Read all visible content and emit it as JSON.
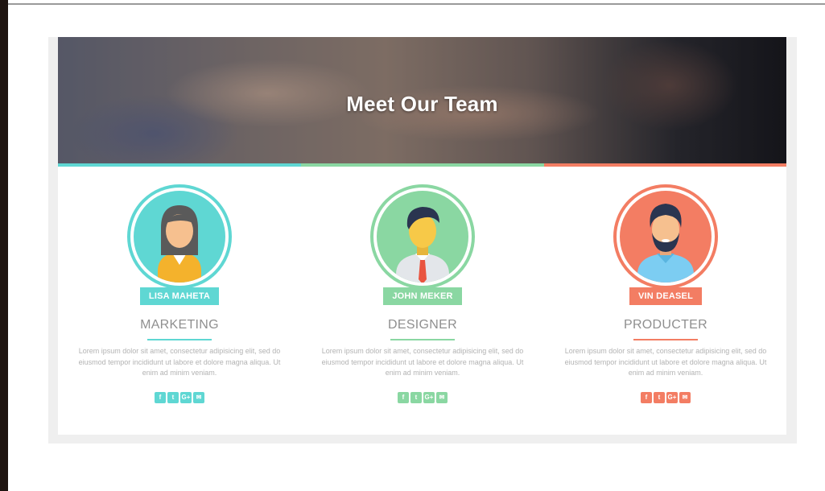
{
  "hero": {
    "title": "Meet Our Team"
  },
  "colors": {
    "teal": "#5fd7d3",
    "green": "#8ad7a2",
    "coral": "#f37d63"
  },
  "members": [
    {
      "name": "LISA MAHETA",
      "role": "MARKETING",
      "description": "Lorem ipsum dolor sit amet, consectetur adipisicing elit, sed do eiusmod tempor incididunt ut labore et dolore magna aliqua. Ut enim ad minim veniam.",
      "socials": [
        "facebook-icon",
        "twitter-icon",
        "google-plus-icon",
        "email-icon"
      ],
      "social_glyphs": [
        "f",
        "t",
        "G+",
        "✉"
      ],
      "accent": "teal"
    },
    {
      "name": "JOHN MEKER",
      "role": "DESIGNER",
      "description": "Lorem ipsum dolor sit amet, consectetur adipisicing elit, sed do eiusmod tempor incididunt ut labore et dolore magna aliqua. Ut enim ad minim veniam.",
      "socials": [
        "facebook-icon",
        "twitter-icon",
        "google-plus-icon",
        "email-icon"
      ],
      "social_glyphs": [
        "f",
        "t",
        "G+",
        "✉"
      ],
      "accent": "green"
    },
    {
      "name": "VIN DEASEL",
      "role": "PRODUCTER",
      "description": "Lorem ipsum dolor sit amet, consectetur adipisicing elit, sed do eiusmod tempor incididunt ut labore et dolore magna aliqua. Ut enim ad minim veniam.",
      "socials": [
        "facebook-icon",
        "twitter-icon",
        "google-plus-icon",
        "email-icon"
      ],
      "social_glyphs": [
        "f",
        "t",
        "G+",
        "✉"
      ],
      "accent": "coral"
    }
  ]
}
